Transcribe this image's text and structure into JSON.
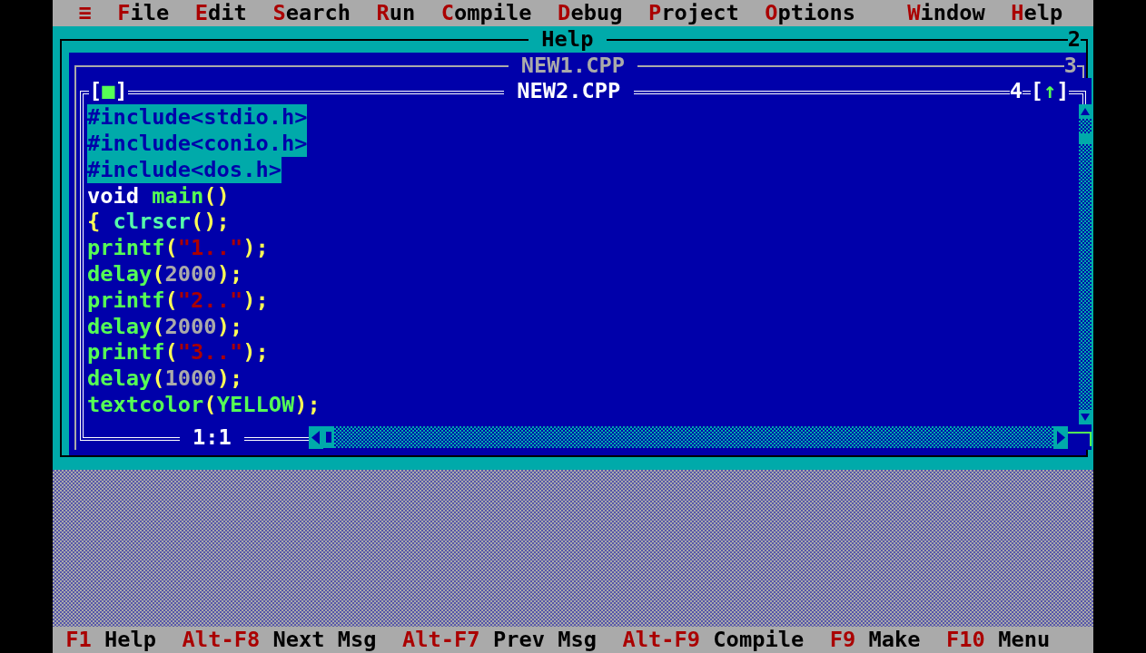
{
  "menu_bar": {
    "items": [
      {
        "label": "≡"
      },
      {
        "label": "File"
      },
      {
        "label": "Edit"
      },
      {
        "label": "Search"
      },
      {
        "label": "Run"
      },
      {
        "label": "Compile"
      },
      {
        "label": "Debug"
      },
      {
        "label": "Project"
      },
      {
        "label": "Options"
      }
    ],
    "right_items": [
      {
        "label": "Window"
      },
      {
        "label": "Help"
      }
    ]
  },
  "windows": [
    {
      "kind": "help",
      "title": "Help",
      "number": "2"
    },
    {
      "kind": "inactive",
      "title": "NEW1.CPP",
      "number": "3"
    },
    {
      "kind": "active",
      "title": "NEW2.CPP",
      "number": "4",
      "close_box": "[■]",
      "zoom_box": "[↑]"
    }
  ],
  "editor": {
    "lines": [
      {
        "selected": true,
        "tokens": [
          {
            "kind": "directive",
            "text": "#include<stdio.h>"
          }
        ]
      },
      {
        "selected": true,
        "tokens": [
          {
            "kind": "directive",
            "text": "#include<conio.h>"
          }
        ]
      },
      {
        "selected": true,
        "tokens": [
          {
            "kind": "directive",
            "text": "#include<dos.h>"
          }
        ]
      },
      {
        "selected": false,
        "tokens": [
          {
            "kind": "keyword",
            "text": "void"
          },
          {
            "kind": "ident",
            "text": " main"
          },
          {
            "kind": "symbol",
            "text": "()"
          }
        ]
      },
      {
        "selected": false,
        "tokens": [
          {
            "kind": "symbol",
            "text": "{"
          },
          {
            "kind": "function",
            "text": " clrscr"
          },
          {
            "kind": "symbol",
            "text": "();"
          }
        ]
      },
      {
        "selected": false,
        "tokens": [
          {
            "kind": "ident",
            "text": "printf"
          },
          {
            "kind": "symbol",
            "text": "("
          },
          {
            "kind": "string",
            "text": "\"1..\""
          },
          {
            "kind": "symbol",
            "text": ");"
          }
        ]
      },
      {
        "selected": false,
        "tokens": [
          {
            "kind": "ident",
            "text": "delay"
          },
          {
            "kind": "symbol",
            "text": "("
          },
          {
            "kind": "number",
            "text": "2000"
          },
          {
            "kind": "symbol",
            "text": ");"
          }
        ]
      },
      {
        "selected": false,
        "tokens": [
          {
            "kind": "ident",
            "text": "printf"
          },
          {
            "kind": "symbol",
            "text": "("
          },
          {
            "kind": "string",
            "text": "\"2..\""
          },
          {
            "kind": "symbol",
            "text": ");"
          }
        ]
      },
      {
        "selected": false,
        "tokens": [
          {
            "kind": "ident",
            "text": "delay"
          },
          {
            "kind": "symbol",
            "text": "("
          },
          {
            "kind": "number",
            "text": "2000"
          },
          {
            "kind": "symbol",
            "text": ");"
          }
        ]
      },
      {
        "selected": false,
        "tokens": [
          {
            "kind": "ident",
            "text": "printf"
          },
          {
            "kind": "symbol",
            "text": "("
          },
          {
            "kind": "string",
            "text": "\"3..\""
          },
          {
            "kind": "symbol",
            "text": ");"
          }
        ]
      },
      {
        "selected": false,
        "tokens": [
          {
            "kind": "ident",
            "text": "delay"
          },
          {
            "kind": "symbol",
            "text": "("
          },
          {
            "kind": "number",
            "text": "1000"
          },
          {
            "kind": "symbol",
            "text": ");"
          }
        ]
      },
      {
        "selected": false,
        "tokens": [
          {
            "kind": "ident",
            "text": "textcolor"
          },
          {
            "kind": "symbol",
            "text": "("
          },
          {
            "kind": "ident",
            "text": "YELLOW"
          },
          {
            "kind": "symbol",
            "text": ");"
          }
        ]
      }
    ],
    "position": "1:1"
  },
  "status_bar": {
    "items": [
      {
        "key": "F1",
        "label": "Help"
      },
      {
        "key": "Alt-F8",
        "label": "Next Msg"
      },
      {
        "key": "Alt-F7",
        "label": "Prev Msg"
      },
      {
        "key": "Alt-F9",
        "label": "Compile"
      },
      {
        "key": "F9",
        "label": "Make"
      },
      {
        "key": "F10",
        "label": "Menu"
      }
    ]
  }
}
